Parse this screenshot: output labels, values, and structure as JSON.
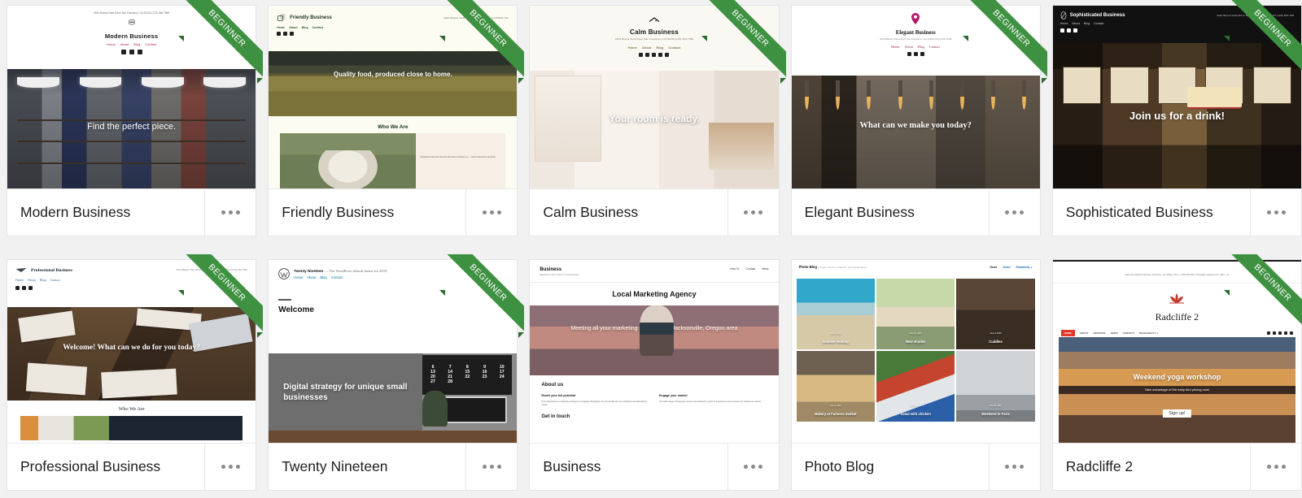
{
  "page": {
    "background_color": "#f1f1f1",
    "badge_color": "#3f9142",
    "badge_label": "BEGINNER",
    "menu_icon": "ellipsis-horizontal-icon"
  },
  "themes": [
    {
      "name": "Modern Business",
      "badge": "BEGINNER",
      "site": {
        "address": "4324 Buena Vista Drive San Francisco, CA 33234 (123) 456-7890",
        "brand": "Modern Business",
        "nav": [
          "Home",
          "About",
          "Blog",
          "Contact"
        ],
        "social": [
          "facebook-icon",
          "twitter-icon",
          "instagram-icon"
        ],
        "hero_caption": "Find the perfect piece."
      }
    },
    {
      "name": "Friendly Business",
      "badge": "BEGINNER",
      "site": {
        "address": "4324 Buena Vista Drive San Francisco, CA 33234 (123) 456-7890",
        "brand": "Friendly Business",
        "nav": [
          "Home",
          "About",
          "Blog",
          "Contact"
        ],
        "social": [
          "facebook-icon",
          "twitter-icon",
          "instagram-icon"
        ],
        "hero_caption": "Quality food, produced close to home.",
        "section_title": "Who We Are",
        "body_text": "Dedicated staff who love the land that nourishes us — that's what we're all about."
      }
    },
    {
      "name": "Calm Business",
      "badge": "BEGINNER",
      "site": {
        "brand": "Calm Business",
        "address": "4324 Buena Vista Drive San Francisco, CA 33234 (123) 456-7890",
        "nav": [
          "Home",
          "About",
          "Blog",
          "Contact"
        ],
        "social": [
          "facebook-icon",
          "twitter-icon",
          "youtube-icon",
          "instagram-icon",
          "pinterest-icon"
        ],
        "hero_caption": "Your room is ready."
      }
    },
    {
      "name": "Elegant Business",
      "badge": "BEGINNER",
      "site": {
        "brand": "Elegant Business",
        "address": "4324 Buena Vista Drive San Francisco, CA 33234 (123) 456-7890",
        "nav": [
          "Home",
          "About",
          "Blog",
          "Contact"
        ],
        "social": [
          "facebook-icon",
          "twitter-icon",
          "instagram-icon"
        ],
        "hero_caption": "What can we make you today?"
      }
    },
    {
      "name": "Sophisticated Business",
      "badge": "BEGINNER",
      "site": {
        "brand": "Sophisticated Business",
        "address": "4324 Buena Vista Drive San Francisco, CA 33234 (123) 456-7890",
        "nav": [
          "Home",
          "About",
          "Blog",
          "Contact"
        ],
        "social": [
          "facebook-icon",
          "twitter-icon",
          "instagram-icon"
        ],
        "hero_caption": "Join us for a drink!"
      }
    },
    {
      "name": "Professional Business",
      "badge": "BEGINNER",
      "site": {
        "brand": "Professional Business",
        "address": "4324 Buena Vista Drive San Francisco, CA 33234 (123) 456-7890",
        "nav": [
          "Home",
          "About",
          "Blog",
          "Contact"
        ],
        "social": [
          "facebook-icon",
          "twitter-icon",
          "instagram-icon"
        ],
        "hero_caption": "Welcome! What can we do for you today?",
        "section_title": "Who We Are"
      }
    },
    {
      "name": "Twenty Nineteen",
      "badge": "BEGINNER",
      "site": {
        "brand": "Twenty Nineteen",
        "tagline": "— The WordPress default theme for 2019",
        "nav": [
          "Home",
          "About",
          "Blog",
          "Contact"
        ],
        "section_title": "Welcome",
        "hero_caption": "Digital strategy for unique small businesses",
        "calendar_numbers": [
          "6",
          "7",
          "8",
          "9",
          "10",
          "13",
          "14",
          "15",
          "16",
          "17",
          "20",
          "21",
          "22",
          "23",
          "24",
          "27",
          "28"
        ]
      }
    },
    {
      "name": "Business",
      "badge": null,
      "site": {
        "brand": "Business",
        "tagline": "Marketing made simple for small business",
        "nav": [
          "How To",
          "Contact",
          "News"
        ],
        "page_title": "Local Marketing Agency",
        "hero_caption": "Meeting all your marketing needs in the Jacksonville, Oregon area",
        "about_title": "About us",
        "columns": [
          {
            "heading": "Reach your full potential",
            "text": "From developing a marketing strategy to managing campaigns, we can handle all your marketing and advertising needs."
          },
          {
            "heading": "Engage your market",
            "text": "Our wide range of language services are backed by years of experience and a passion for helping our clients."
          }
        ],
        "contact_title": "Get in touch"
      }
    },
    {
      "name": "Photo Blog",
      "badge": null,
      "site": {
        "brand": "Photo Blog",
        "tagline": "a single column, multicolor, grid-based theme",
        "nav": [
          "Home",
          "About",
          "Readability ∨"
        ],
        "posts": [
          {
            "title": "Summer Holiday",
            "date": "June 8, 2019"
          },
          {
            "title": "New shades",
            "date": "June 21, 2019"
          },
          {
            "title": "Cuddles",
            "date": "June 4, 2019"
          },
          {
            "title": "Bakery at Farmers market",
            "date": "June 2, 2019"
          },
          {
            "title": "Salad with chicken",
            "date": "June 1, 2019"
          },
          {
            "title": "Weekend in Paris",
            "date": "May 29, 2019"
          }
        ]
      }
    },
    {
      "name": "Radcliffe 2",
      "badge": "BEGINNER",
      "site": {
        "brand": "Radcliffe 2",
        "topbar": "4400 International Gateway, Columbus, OH 43219, USA   |   +1 000-000-000   |   contact@mydomain.com   |   Mon - Fri",
        "nav": [
          "HOME",
          "ABOUT",
          "SERVICES",
          "NEWS",
          "CONTACT",
          "READABILITY ∨"
        ],
        "social": [
          "twitter-icon",
          "facebook-icon",
          "instagram-icon",
          "pinterest-icon",
          "mail-icon"
        ],
        "hero_caption": "Weekend yoga workshop",
        "hero_sub": "Take advantage of the early bird pricing now!",
        "cta": "Sign up!"
      }
    }
  ]
}
